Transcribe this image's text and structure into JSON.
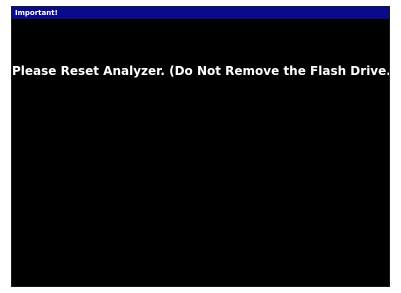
{
  "dialog": {
    "title": "Important!",
    "message": "Please Reset Analyzer. (Do Not Remove the Flash Drive.)"
  },
  "colors": {
    "title_bar": "#0a0a8c",
    "background": "#000000",
    "text": "#ffffff"
  }
}
